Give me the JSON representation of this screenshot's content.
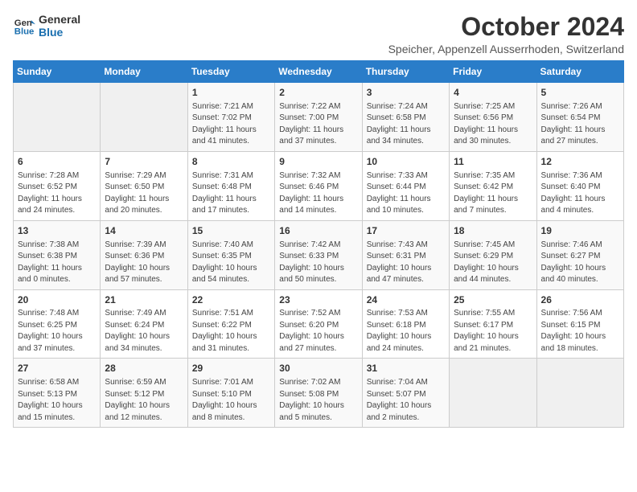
{
  "header": {
    "logo_line1": "General",
    "logo_line2": "Blue",
    "month_title": "October 2024",
    "subtitle": "Speicher, Appenzell Ausserrhoden, Switzerland"
  },
  "days_of_week": [
    "Sunday",
    "Monday",
    "Tuesday",
    "Wednesday",
    "Thursday",
    "Friday",
    "Saturday"
  ],
  "weeks": [
    [
      {
        "day": "",
        "info": ""
      },
      {
        "day": "",
        "info": ""
      },
      {
        "day": "1",
        "info": "Sunrise: 7:21 AM\nSunset: 7:02 PM\nDaylight: 11 hours and 41 minutes."
      },
      {
        "day": "2",
        "info": "Sunrise: 7:22 AM\nSunset: 7:00 PM\nDaylight: 11 hours and 37 minutes."
      },
      {
        "day": "3",
        "info": "Sunrise: 7:24 AM\nSunset: 6:58 PM\nDaylight: 11 hours and 34 minutes."
      },
      {
        "day": "4",
        "info": "Sunrise: 7:25 AM\nSunset: 6:56 PM\nDaylight: 11 hours and 30 minutes."
      },
      {
        "day": "5",
        "info": "Sunrise: 7:26 AM\nSunset: 6:54 PM\nDaylight: 11 hours and 27 minutes."
      }
    ],
    [
      {
        "day": "6",
        "info": "Sunrise: 7:28 AM\nSunset: 6:52 PM\nDaylight: 11 hours and 24 minutes."
      },
      {
        "day": "7",
        "info": "Sunrise: 7:29 AM\nSunset: 6:50 PM\nDaylight: 11 hours and 20 minutes."
      },
      {
        "day": "8",
        "info": "Sunrise: 7:31 AM\nSunset: 6:48 PM\nDaylight: 11 hours and 17 minutes."
      },
      {
        "day": "9",
        "info": "Sunrise: 7:32 AM\nSunset: 6:46 PM\nDaylight: 11 hours and 14 minutes."
      },
      {
        "day": "10",
        "info": "Sunrise: 7:33 AM\nSunset: 6:44 PM\nDaylight: 11 hours and 10 minutes."
      },
      {
        "day": "11",
        "info": "Sunrise: 7:35 AM\nSunset: 6:42 PM\nDaylight: 11 hours and 7 minutes."
      },
      {
        "day": "12",
        "info": "Sunrise: 7:36 AM\nSunset: 6:40 PM\nDaylight: 11 hours and 4 minutes."
      }
    ],
    [
      {
        "day": "13",
        "info": "Sunrise: 7:38 AM\nSunset: 6:38 PM\nDaylight: 11 hours and 0 minutes."
      },
      {
        "day": "14",
        "info": "Sunrise: 7:39 AM\nSunset: 6:36 PM\nDaylight: 10 hours and 57 minutes."
      },
      {
        "day": "15",
        "info": "Sunrise: 7:40 AM\nSunset: 6:35 PM\nDaylight: 10 hours and 54 minutes."
      },
      {
        "day": "16",
        "info": "Sunrise: 7:42 AM\nSunset: 6:33 PM\nDaylight: 10 hours and 50 minutes."
      },
      {
        "day": "17",
        "info": "Sunrise: 7:43 AM\nSunset: 6:31 PM\nDaylight: 10 hours and 47 minutes."
      },
      {
        "day": "18",
        "info": "Sunrise: 7:45 AM\nSunset: 6:29 PM\nDaylight: 10 hours and 44 minutes."
      },
      {
        "day": "19",
        "info": "Sunrise: 7:46 AM\nSunset: 6:27 PM\nDaylight: 10 hours and 40 minutes."
      }
    ],
    [
      {
        "day": "20",
        "info": "Sunrise: 7:48 AM\nSunset: 6:25 PM\nDaylight: 10 hours and 37 minutes."
      },
      {
        "day": "21",
        "info": "Sunrise: 7:49 AM\nSunset: 6:24 PM\nDaylight: 10 hours and 34 minutes."
      },
      {
        "day": "22",
        "info": "Sunrise: 7:51 AM\nSunset: 6:22 PM\nDaylight: 10 hours and 31 minutes."
      },
      {
        "day": "23",
        "info": "Sunrise: 7:52 AM\nSunset: 6:20 PM\nDaylight: 10 hours and 27 minutes."
      },
      {
        "day": "24",
        "info": "Sunrise: 7:53 AM\nSunset: 6:18 PM\nDaylight: 10 hours and 24 minutes."
      },
      {
        "day": "25",
        "info": "Sunrise: 7:55 AM\nSunset: 6:17 PM\nDaylight: 10 hours and 21 minutes."
      },
      {
        "day": "26",
        "info": "Sunrise: 7:56 AM\nSunset: 6:15 PM\nDaylight: 10 hours and 18 minutes."
      }
    ],
    [
      {
        "day": "27",
        "info": "Sunrise: 6:58 AM\nSunset: 5:13 PM\nDaylight: 10 hours and 15 minutes."
      },
      {
        "day": "28",
        "info": "Sunrise: 6:59 AM\nSunset: 5:12 PM\nDaylight: 10 hours and 12 minutes."
      },
      {
        "day": "29",
        "info": "Sunrise: 7:01 AM\nSunset: 5:10 PM\nDaylight: 10 hours and 8 minutes."
      },
      {
        "day": "30",
        "info": "Sunrise: 7:02 AM\nSunset: 5:08 PM\nDaylight: 10 hours and 5 minutes."
      },
      {
        "day": "31",
        "info": "Sunrise: 7:04 AM\nSunset: 5:07 PM\nDaylight: 10 hours and 2 minutes."
      },
      {
        "day": "",
        "info": ""
      },
      {
        "day": "",
        "info": ""
      }
    ]
  ]
}
